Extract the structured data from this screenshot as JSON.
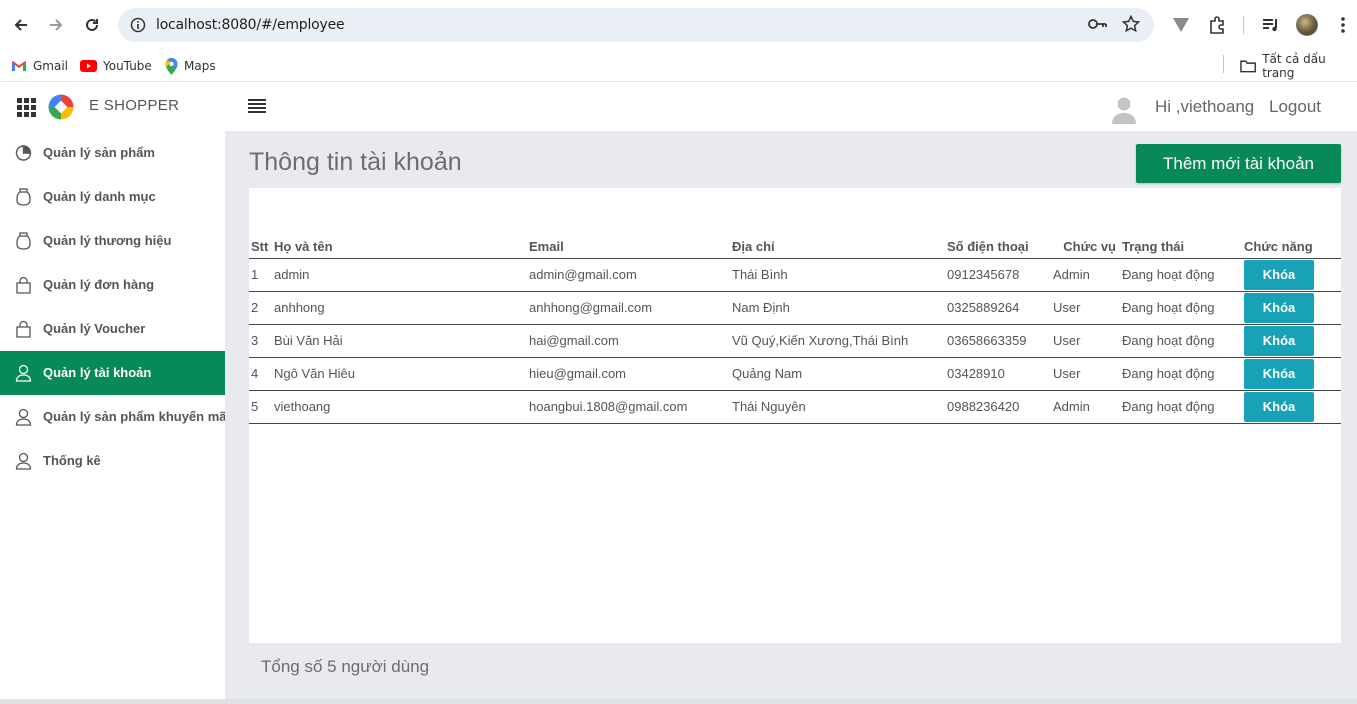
{
  "browser": {
    "url": "localhost:8080/#/employee",
    "bookmarks": [
      {
        "label": "Gmail",
        "icon": "gmail-icon"
      },
      {
        "label": "YouTube",
        "icon": "youtube-icon"
      },
      {
        "label": "Maps",
        "icon": "maps-icon"
      }
    ],
    "all_bookmarks": "Tất cả dấu trang"
  },
  "header": {
    "brand": "E SHOPPER",
    "greeting": "Hi ,viethoang",
    "logout": "Logout"
  },
  "sidebar": {
    "items": [
      {
        "label": "Quản lý sản phẩm",
        "icon": "pie-chart-icon",
        "active": false
      },
      {
        "label": "Quản lý danh mục",
        "icon": "jar-icon",
        "active": false
      },
      {
        "label": "Quản lý thương hiệu",
        "icon": "jar-icon",
        "active": false
      },
      {
        "label": "Quản lý đơn hàng",
        "icon": "bag-icon",
        "active": false
      },
      {
        "label": "Quản lý Voucher",
        "icon": "bag-icon",
        "active": false
      },
      {
        "label": "Quản lý tài khoản",
        "icon": "user-icon",
        "active": true
      },
      {
        "label": "Quản lý sản phẩm khuyến mãi",
        "icon": "user-icon",
        "active": false
      },
      {
        "label": "Thống kê",
        "icon": "user-icon",
        "active": false
      }
    ]
  },
  "main": {
    "title": "Thông tin tài khoản",
    "add_button": "Thêm mới tài khoản",
    "columns": [
      "Stt",
      "Họ và tên",
      "Email",
      "Địa chỉ",
      "Số điện thoại",
      "Chức vụ",
      "Trạng thái",
      "Chức năng"
    ],
    "rows": [
      {
        "stt": "1",
        "name": "admin",
        "email": "admin@gmail.com",
        "address": "Thái Bình",
        "phone": "0912345678",
        "role": "Admin",
        "status": "Đang hoạt động",
        "action": "Khóa"
      },
      {
        "stt": "2",
        "name": "anhhong",
        "email": "anhhong@gmail.com",
        "address": "Nam Định",
        "phone": "0325889264",
        "role": "User",
        "status": "Đang hoạt động",
        "action": "Khóa"
      },
      {
        "stt": "3",
        "name": "Bùi Văn Hải",
        "email": "hai@gmail.com",
        "address": "Vũ Quý,Kiến Xương,Thái Bình",
        "phone": "03658663359",
        "role": "User",
        "status": "Đang hoạt động",
        "action": "Khóa"
      },
      {
        "stt": "4",
        "name": "Ngô Văn Hiêu",
        "email": "hieu@gmail.com",
        "address": "Quảng Nam",
        "phone": "03428910",
        "role": "User",
        "status": "Đang hoạt động",
        "action": "Khóa"
      },
      {
        "stt": "5",
        "name": "viethoang",
        "email": "hoangbui.1808@gmail.com",
        "address": "Thái Nguyên",
        "phone": "0988236420",
        "role": "Admin",
        "status": "Đang hoạt động",
        "action": "Khóa"
      }
    ],
    "total_text": "Tổng số 5 người dùng"
  },
  "colors": {
    "accent_green": "#078a57",
    "lock_button": "#17a2b8",
    "main_background": "#e8eaee"
  }
}
